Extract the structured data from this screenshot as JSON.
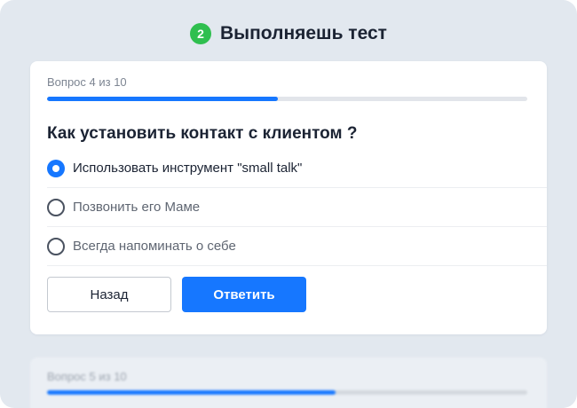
{
  "header": {
    "step_number": "2",
    "title": "Выполняешь тест"
  },
  "current": {
    "progress_label": "Вопрос 4 из 10",
    "progress_fraction": 0.48,
    "question": "Как установить контакт с клиентом ?",
    "options": [
      {
        "label": "Использовать инструмент \"small talk\"",
        "selected": true
      },
      {
        "label": "Позвонить его Маме",
        "selected": false
      },
      {
        "label": "Всегда напоминать о себе",
        "selected": false
      }
    ],
    "back_label": "Назад",
    "submit_label": "Ответить"
  },
  "next": {
    "progress_label": "Вопрос 5 из 10",
    "progress_fraction": 0.6
  },
  "colors": {
    "accent": "#1677ff",
    "step_badge": "#2fbf4f"
  }
}
